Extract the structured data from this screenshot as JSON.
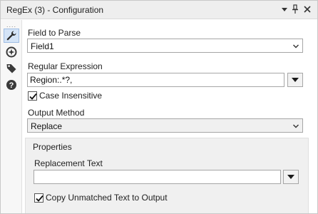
{
  "window": {
    "title": "RegEx (3) - Configuration",
    "controls": {
      "dropdown_icon": "triangle-down-icon",
      "pin_icon": "pin-icon",
      "close_icon": "close-icon"
    }
  },
  "toolstrip": {
    "grip": "....",
    "tools": [
      {
        "name": "configuration",
        "icon": "wrench-icon",
        "active": true
      },
      {
        "name": "layout",
        "icon": "compass-icon",
        "active": false
      },
      {
        "name": "annotation",
        "icon": "tag-icon",
        "active": false
      },
      {
        "name": "help",
        "icon": "help-icon",
        "active": false
      }
    ]
  },
  "form": {
    "field_to_parse": {
      "label": "Field to Parse",
      "value": "Field1"
    },
    "regular_expression": {
      "label": "Regular Expression",
      "value": "Region:.*?,"
    },
    "case_insensitive": {
      "label": "Case Insensitive",
      "checked": true
    },
    "output_method": {
      "label": "Output Method",
      "value": "Replace"
    },
    "properties": {
      "title": "Properties",
      "replacement_text": {
        "label": "Replacement Text",
        "value": ""
      },
      "copy_unmatched": {
        "label": "Copy Unmatched Text to Output",
        "checked": true
      }
    }
  },
  "colors": {
    "titlebar_bg": "#eeeeee",
    "active_tool_bg": "#d4e4f7",
    "icon_dark": "#3a3a3a",
    "panel_bg": "#f0f0f0"
  }
}
